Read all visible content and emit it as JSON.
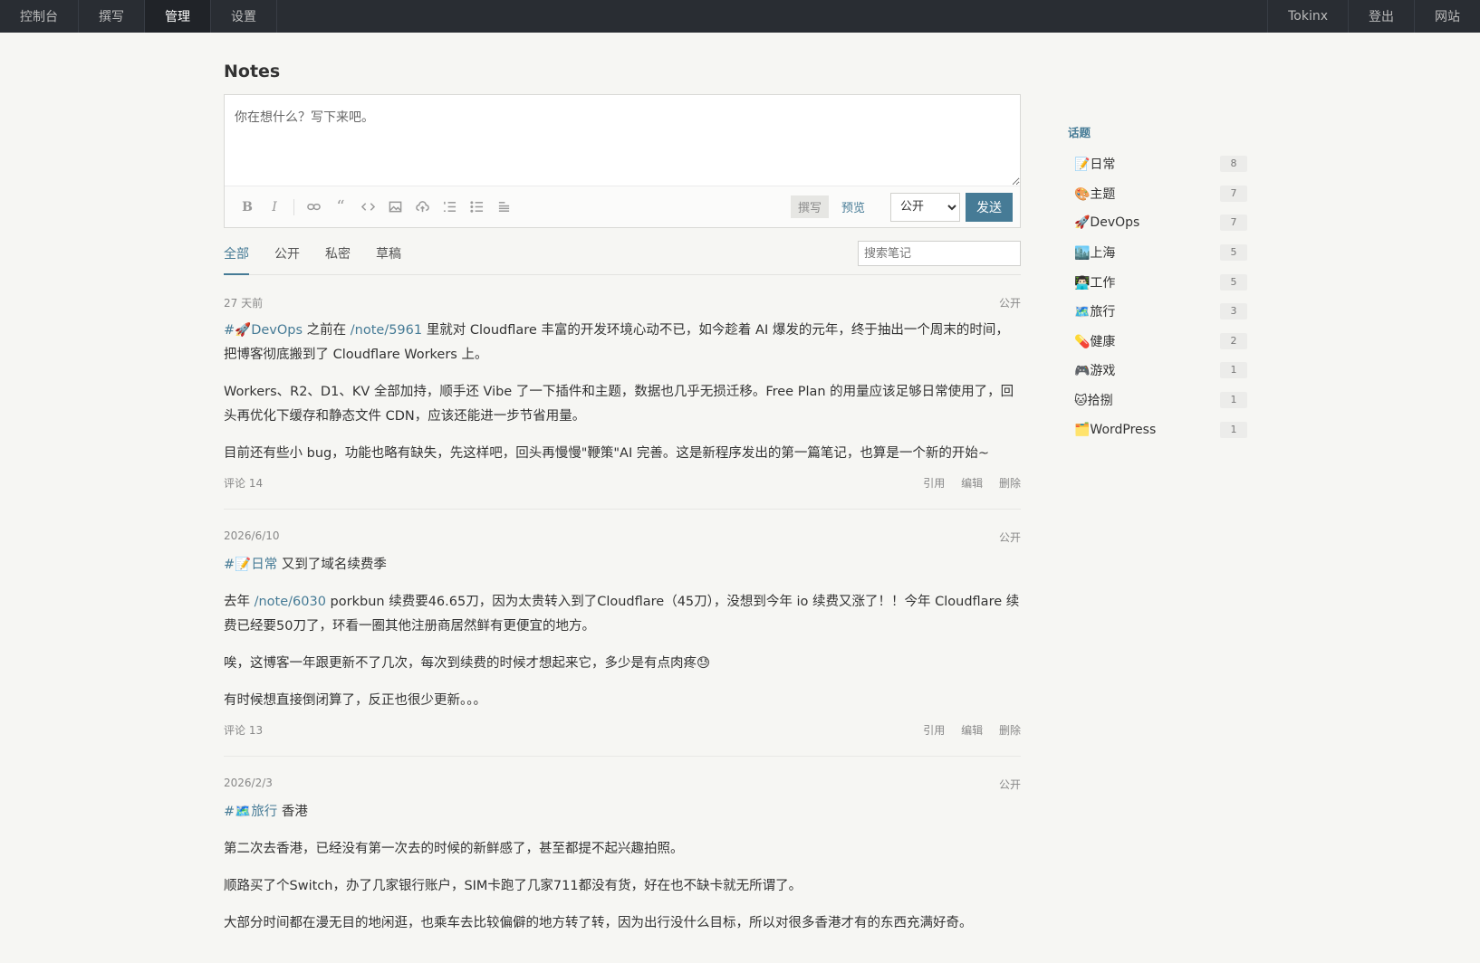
{
  "nav": {
    "left": [
      "控制台",
      "撰写",
      "管理",
      "设置"
    ],
    "right": [
      "Tokinx",
      "登出",
      "网站"
    ]
  },
  "page_title": "Notes",
  "editor": {
    "placeholder": "你在想什么？写下来吧。",
    "mode_write": "撰写",
    "mode_preview": "预览",
    "visibility_selected": "公开",
    "send_label": "发送"
  },
  "filters": {
    "tabs": [
      "全部",
      "公开",
      "私密",
      "草稿"
    ],
    "search_placeholder": "搜索笔记"
  },
  "notes": [
    {
      "date": "27 天前",
      "visibility": "公开",
      "tag": "#🚀DevOps",
      "p1_a": " 之前在 ",
      "p1_link": "/note/5961",
      "p1_b": " 里就对 Cloudflare 丰富的开发环境心动不已，如今趁着 AI 爆发的元年，终于抽出一个周末的时间，把博客彻底搬到了 Cloudflare Workers 上。",
      "p2": "Workers、R2、D1、KV 全部加持，顺手还 Vibe 了一下插件和主题，数据也几乎无损迁移。Free Plan 的用量应该足够日常使用了，回头再优化下缓存和静态文件 CDN，应该还能进一步节省用量。",
      "p3": "目前还有些小 bug，功能也略有缺失，先这样吧，回头再慢慢\"鞭策\"AI 完善。这是新程序发出的第一篇笔记，也算是一个新的开始~",
      "comments": "评论 14"
    },
    {
      "date": "2026/6/10",
      "visibility": "公开",
      "tag": "#📝日常",
      "p1_a": " 又到了域名续费季",
      "p2_a": "去年 ",
      "p2_link": "/note/6030",
      "p2_b": " porkbun 续费要46.65刀，因为太贵转入到了Cloudflare（45刀），没想到今年 io 续费又涨了！！今年 Cloudflare 续费已经要50刀了，环看一圈其他注册商居然鲜有更便宜的地方。",
      "p3": "唉，这博客一年跟更新不了几次，每次到续费的时候才想起来它，多少是有点肉疼😓",
      "p4": "有时候想直接倒闭算了，反正也很少更新。。。",
      "comments": "评论 13"
    },
    {
      "date": "2026/2/3",
      "visibility": "公开",
      "tag": "#🗺️旅行",
      "p1_a": " 香港",
      "p2": "第二次去香港，已经没有第一次去的时候的新鲜感了，甚至都提不起兴趣拍照。",
      "p3": "顺路买了个Switch，办了几家银行账户，SIM卡跑了几家711都没有货，好在也不缺卡就无所谓了。",
      "p4": "大部分时间都在漫无目的地闲逛，也乘车去比较偏僻的地方转了转，因为出行没什么目标，所以对很多香港才有的东西充满好奇。"
    }
  ],
  "note_actions": [
    "引用",
    "编辑",
    "删除"
  ],
  "sidebar": {
    "title": "话题",
    "topics": [
      {
        "name": "📝日常",
        "count": "8"
      },
      {
        "name": "🎨主题",
        "count": "7"
      },
      {
        "name": "🚀DevOps",
        "count": "7"
      },
      {
        "name": "🏙️上海",
        "count": "5"
      },
      {
        "name": "👨🏻‍💻工作",
        "count": "5"
      },
      {
        "name": "🗺️旅行",
        "count": "3"
      },
      {
        "name": "💊健康",
        "count": "2"
      },
      {
        "name": "🎮游戏",
        "count": "1"
      },
      {
        "name": "🐱拾捌",
        "count": "1"
      },
      {
        "name": "🗂️WordPress",
        "count": "1"
      }
    ]
  }
}
